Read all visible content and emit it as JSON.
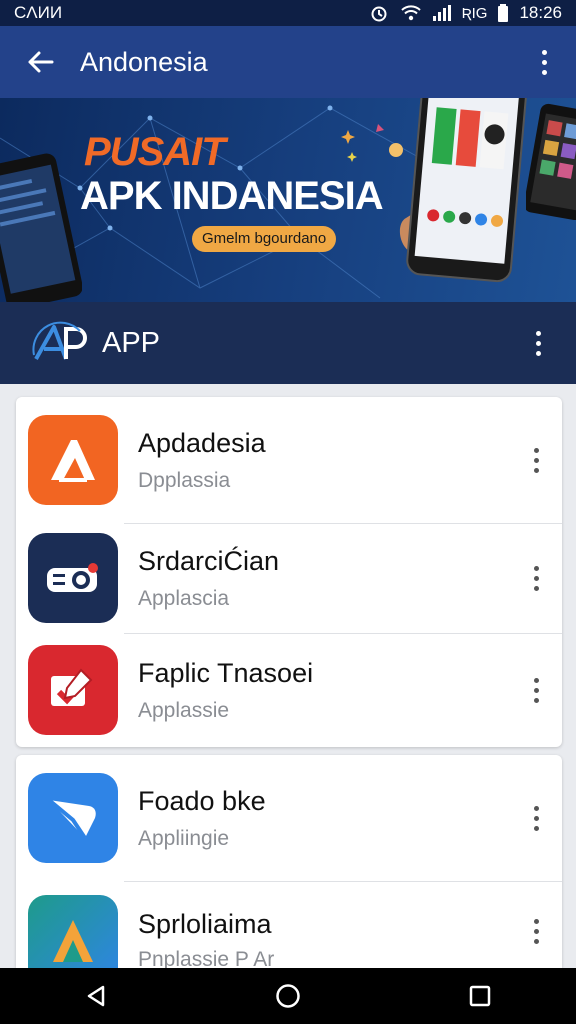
{
  "status_bar": {
    "carrier": "CɅИИ",
    "time": "18:26",
    "signal_text": "ƦІG"
  },
  "app_bar": {
    "title": "Andonesia"
  },
  "banner": {
    "line1": "PUSAIT",
    "line2": "APK INDANESIA",
    "pill": "Gmelm bgourdano"
  },
  "section": {
    "title": "APP"
  },
  "apps": [
    {
      "title": "Apdadesia",
      "subtitle": "Dpplassia",
      "icon": "a-logo-icon",
      "color": "#f26522"
    },
    {
      "title": "SrdarciĆian",
      "subtitle": "Applascia",
      "icon": "projector-icon",
      "color": "#1b2d55"
    },
    {
      "title": "Faplic Tnasoei",
      "subtitle": "Applassie",
      "icon": "pen-icon",
      "color": "#d9282f"
    },
    {
      "title": "Foado bke",
      "subtitle": "Appliingie",
      "icon": "chat-icon",
      "color": "#2f84e6"
    },
    {
      "title": "Sprloliaima",
      "subtitle": "Pnplassie P Ar",
      "icon": "triangle-a-icon",
      "color": "#1e9b8a"
    }
  ]
}
